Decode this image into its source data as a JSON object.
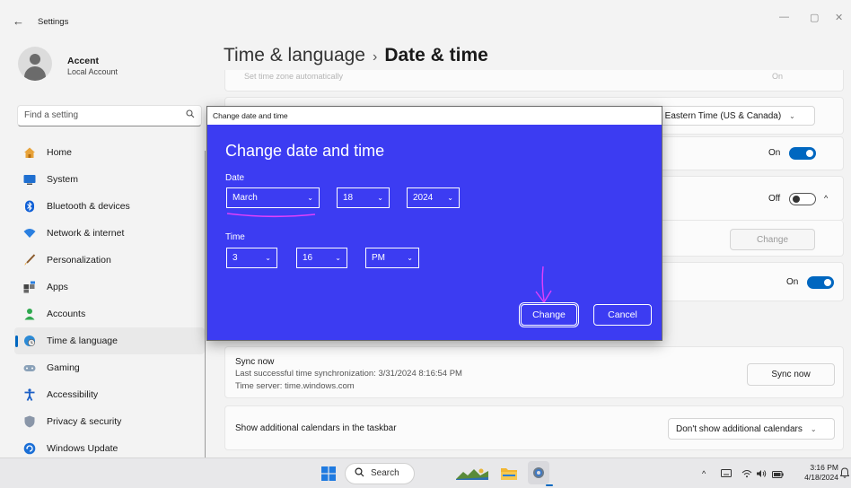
{
  "window": {
    "back_glyph": "←",
    "title": "Settings",
    "minimize": "—",
    "maximize": "▢",
    "close": "✕"
  },
  "profile": {
    "name": "Accent",
    "subtitle": "Local Account"
  },
  "search": {
    "placeholder": "Find a setting"
  },
  "nav": {
    "items": [
      {
        "label": "Home",
        "icon": "home-icon"
      },
      {
        "label": "System",
        "icon": "system-icon"
      },
      {
        "label": "Bluetooth & devices",
        "icon": "bluetooth-icon"
      },
      {
        "label": "Network & internet",
        "icon": "wifi-icon"
      },
      {
        "label": "Personalization",
        "icon": "brush-icon"
      },
      {
        "label": "Apps",
        "icon": "apps-icon"
      },
      {
        "label": "Accounts",
        "icon": "person-icon"
      },
      {
        "label": "Time & language",
        "icon": "globe-clock-icon",
        "active": true
      },
      {
        "label": "Gaming",
        "icon": "gamepad-icon"
      },
      {
        "label": "Accessibility",
        "icon": "accessibility-icon"
      },
      {
        "label": "Privacy & security",
        "icon": "shield-icon"
      },
      {
        "label": "Windows Update",
        "icon": "update-icon"
      }
    ]
  },
  "header": {
    "parent": "Time & language",
    "separator": "›",
    "current": "Date & time"
  },
  "main": {
    "faded_row_text": "Set time zone automatically",
    "faded_right_text": "On",
    "timezone_value": "0) Eastern Time (US & Canada)",
    "row_toggle_1": {
      "label": "On",
      "state": "on"
    },
    "row_toggle_2": {
      "label": "Off",
      "state": "off",
      "expand": "^"
    },
    "change_button": "Change",
    "row_toggle_3": {
      "label": "On",
      "state": "on"
    },
    "sync": {
      "title": "Sync now",
      "last_sync": "Last successful time synchronization: 3/31/2024 8:16:54 PM",
      "server": "Time server: time.windows.com",
      "button": "Sync now"
    },
    "calendars": {
      "label": "Show additional calendars in the taskbar",
      "value": "Don't show additional calendars"
    }
  },
  "dialog": {
    "window_title": "Change date and time",
    "heading": "Change date and time",
    "date_label": "Date",
    "month": "March",
    "day": "18",
    "year": "2024",
    "time_label": "Time",
    "hour": "3",
    "minute": "16",
    "ampm": "PM",
    "change_button": "Change",
    "cancel_button": "Cancel",
    "chevron": "⌄"
  },
  "annotations": {
    "color": "#e040fb"
  },
  "taskbar": {
    "search_label": "Search",
    "time": "3:16 PM",
    "date": "4/18/2024"
  },
  "colors": {
    "accent": "#0067c0",
    "dialog_bg": "#3c3cf2"
  }
}
